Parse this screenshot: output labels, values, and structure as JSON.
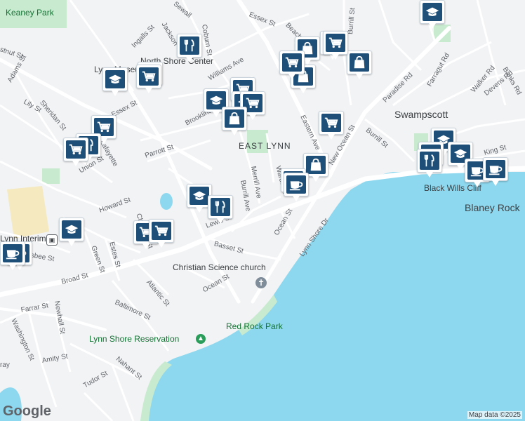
{
  "map": {
    "colors": {
      "land": "#f2f3f5",
      "water": "#8ed8ef",
      "road_major": "#ffffff",
      "road_minor": "#ffffff",
      "park": "#c8ebd0",
      "marker": "#1e4f78"
    }
  },
  "places": {
    "swampscott": "Swampscott",
    "east_lynn": "EAST LYNN",
    "keaney_park": "Keaney Park",
    "black_wills_cliff": "Black Wills Cliff",
    "blaney_rock": "Blaney Rock",
    "red_rock_park": "Red Rock Park",
    "lynn_shore_reservation": "Lynn Shore Reservation",
    "christian_science_church": "Christian Science church",
    "lynn_museum": "Lynn Museum",
    "north_shore_center": "North Shore Center",
    "lynn_interim": "Lynn Interim"
  },
  "streets": {
    "essex_top": "Essex St",
    "essex_left": "Essex St",
    "chestnut": "stnut St",
    "adams": "Adams St",
    "lily": "Lily St",
    "sheridan": "Sheridan St",
    "ingalls": "Ingalls St",
    "jackson": "Jackson",
    "sewall": "Sewall",
    "coburn": "Coburn St",
    "williams": "Williams Ave",
    "beach": "Beach",
    "burrill_top": "Burrill St",
    "paradise": "Paradise Rd",
    "farragut": "Farragut Rd",
    "walker": "Walker Rd",
    "devens": "Devens Rd",
    "banks": "Banks Rd",
    "eastern": "Eastern Ave",
    "new_ocean": "New Ocean St",
    "burrill_right": "Burrill St",
    "king": "King St",
    "brookline": "Brookline St",
    "parrott": "Parrott St",
    "union": "Union St",
    "lafayette": "Lafayette",
    "merrill": "Merrill Ave",
    "burrill_ave": "Burrill Ave",
    "wardwell": "Wardwell",
    "ocean_upper": "Ocean St",
    "ocean_lower": "Ocean St",
    "lewis": "Lewis St",
    "basset": "Basset St",
    "howard": "Howard St",
    "chestnut_mid": "Chestnut St",
    "green": "Green St",
    "estes": "Estes St",
    "broad": "Broad St",
    "atlantic": "Atlantic St",
    "baltimore": "Baltimore St",
    "farrar": "Farrar St",
    "newhall": "Newhall St",
    "washington": "Washington St",
    "amity": "Amity St",
    "nahant": "Nahant St",
    "tudor": "Tudor St",
    "lynn_shore_dr": "Lynn Shore Dr",
    "lisbee": "Lisbee St",
    "ray": "ray"
  },
  "markers": [
    {
      "icon": "school"
    },
    {
      "icon": "school"
    },
    {
      "icon": "cart"
    },
    {
      "icon": "shop"
    },
    {
      "icon": "food"
    },
    {
      "icon": "food"
    },
    {
      "icon": "shop"
    },
    {
      "icon": "shop"
    },
    {
      "icon": "school"
    },
    {
      "icon": "cart"
    },
    {
      "icon": "school"
    },
    {
      "icon": "cart"
    },
    {
      "icon": "shop"
    },
    {
      "icon": "cart"
    },
    {
      "icon": "food"
    },
    {
      "icon": "cart"
    },
    {
      "icon": "cart"
    },
    {
      "icon": "school"
    },
    {
      "icon": "cart"
    },
    {
      "icon": "cart"
    },
    {
      "icon": "shop"
    },
    {
      "icon": "coffee"
    },
    {
      "icon": "coffee"
    },
    {
      "icon": "school"
    },
    {
      "icon": "food"
    },
    {
      "icon": "cart"
    },
    {
      "icon": "school"
    },
    {
      "icon": "coffee"
    },
    {
      "icon": "coffee"
    },
    {
      "icon": "school"
    },
    {
      "icon": "school"
    },
    {
      "icon": "coffee"
    },
    {
      "icon": "coffee"
    },
    {
      "icon": "cart"
    },
    {
      "icon": "cart"
    },
    {
      "icon": "food"
    }
  ],
  "attribution": "Map data ©2025",
  "logo": "Google"
}
